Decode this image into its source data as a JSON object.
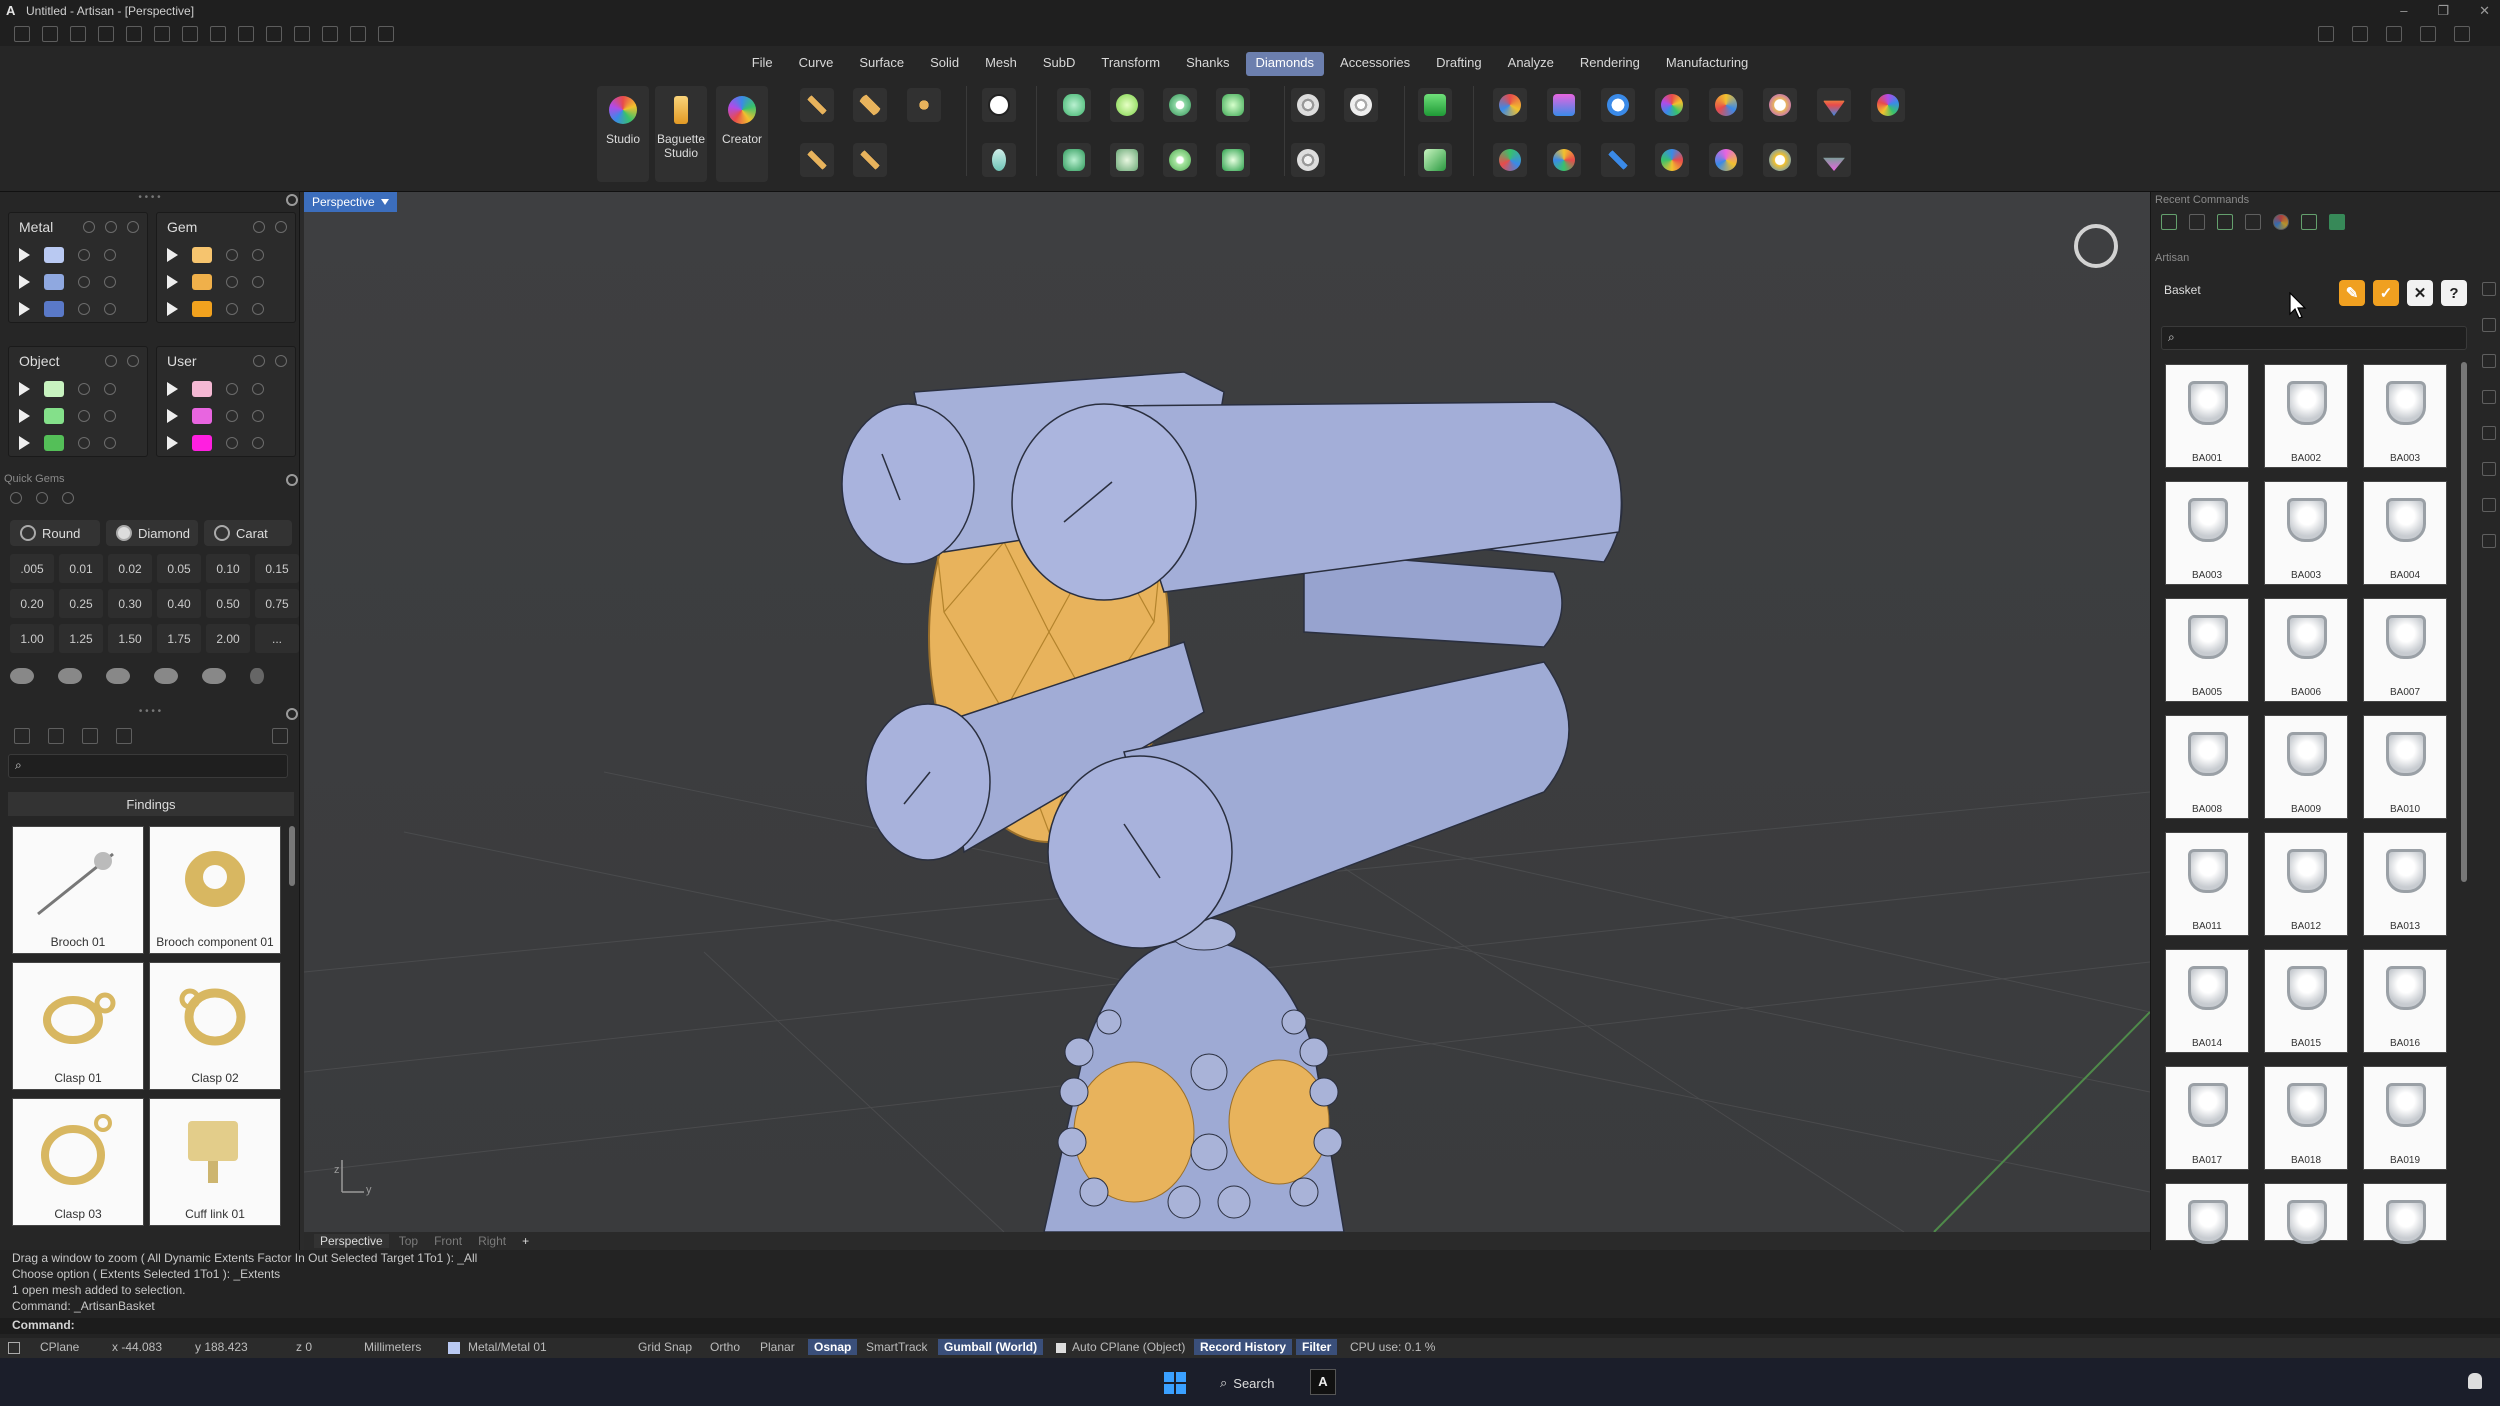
{
  "window": {
    "title": "Untitled - Artisan - [Perspective]",
    "logo": "A",
    "controls": [
      "–",
      "❐",
      "✕"
    ]
  },
  "menu_tabs": [
    "File",
    "Curve",
    "Surface",
    "Solid",
    "Mesh",
    "SubD",
    "Transform",
    "Shanks",
    "Diamonds",
    "Accessories",
    "Drafting",
    "Analyze",
    "Rendering",
    "Manufacturing"
  ],
  "active_tab": "Diamonds",
  "big_tools": [
    {
      "label": "Studio"
    },
    {
      "label": "Baguette Studio"
    },
    {
      "label": "Creator"
    }
  ],
  "layers": {
    "metal": {
      "title": "Metal",
      "colors": [
        "#b9c9f2",
        "#8fa8e0",
        "#5a79c8"
      ]
    },
    "gem": {
      "title": "Gem",
      "colors": [
        "#f6c46e",
        "#f0b04a",
        "#f2a21e"
      ]
    },
    "object": {
      "title": "Object",
      "colors": [
        "#c8f3c0",
        "#84e08a",
        "#54bf58"
      ]
    },
    "user": {
      "title": "User",
      "colors": [
        "#f4b8d3",
        "#e865e0",
        "#ff1fe0"
      ]
    }
  },
  "quick_gems": {
    "title": "Quick Gems",
    "shape_buttons": [
      {
        "label": "Round"
      },
      {
        "label": "Diamond"
      },
      {
        "label": "Carat"
      }
    ],
    "sizes": [
      ".005",
      "0.01",
      "0.02",
      "0.05",
      "0.10",
      "0.15",
      "0.20",
      "0.25",
      "0.30",
      "0.40",
      "0.50",
      "0.75",
      "1.00",
      "1.25",
      "1.50",
      "1.75",
      "2.00",
      "..."
    ]
  },
  "findings": {
    "category": "Findings",
    "items": [
      "Brooch 01",
      "Brooch component 01",
      "Clasp 01",
      "Clasp 02",
      "Clasp 03",
      "Cuff link 01"
    ]
  },
  "viewport": {
    "label": "Perspective",
    "tabs": [
      "Perspective",
      "Top",
      "Front",
      "Right",
      "+"
    ],
    "active": "Perspective",
    "axis_z": "z",
    "axis_y": "y"
  },
  "right_panel": {
    "recent_commands_title": "Recent Commands",
    "artisan_title": "Artisan",
    "basket_field": "Basket",
    "help_label": "?",
    "gems": [
      "BA001",
      "BA002",
      "BA003",
      "BA003",
      "BA003",
      "BA004",
      "BA005",
      "BA006",
      "BA007",
      "BA008",
      "BA009",
      "BA010",
      "BA011",
      "BA012",
      "BA013",
      "BA014",
      "BA015",
      "BA016",
      "BA017",
      "BA018",
      "BA019",
      "",
      "",
      ""
    ]
  },
  "command_history": [
    "Drag a window to zoom ( All  Dynamic  Extents  Factor  In  Out  Selected  Target  1To1 ): _All",
    "Choose option ( Extents  Selected  1To1 ): _Extents",
    "1 open mesh added to selection.",
    "Command: _ArtisanBasket"
  ],
  "command_prompt": "Command:",
  "status": {
    "cplane": "CPlane",
    "x": "x -44.083",
    "y": "y 188.423",
    "z": "z 0",
    "units": "Millimeters",
    "layer": "Metal/Metal 01",
    "layer_color": "#b9c9f2",
    "toggles": [
      {
        "label": "Grid Snap",
        "on": false
      },
      {
        "label": "Ortho",
        "on": false
      },
      {
        "label": "Planar",
        "on": false
      },
      {
        "label": "Osnap",
        "on": true
      },
      {
        "label": "SmartTrack",
        "on": false
      },
      {
        "label": "Gumball (World)",
        "on": true
      },
      {
        "label": "Auto CPlane (Object)",
        "on": false
      },
      {
        "label": "Record History",
        "on": true
      },
      {
        "label": "Filter",
        "on": true
      }
    ],
    "cpu": "CPU use: 0.1 %"
  },
  "taskbar": {
    "search": "Search",
    "app": "A"
  },
  "colors": {
    "accent": "#6c7fae",
    "viewport_label": "#3c6ebd",
    "metal": "#9eaad4",
    "gem": "#e8b35c",
    "orange_btn": "#f0a020"
  }
}
